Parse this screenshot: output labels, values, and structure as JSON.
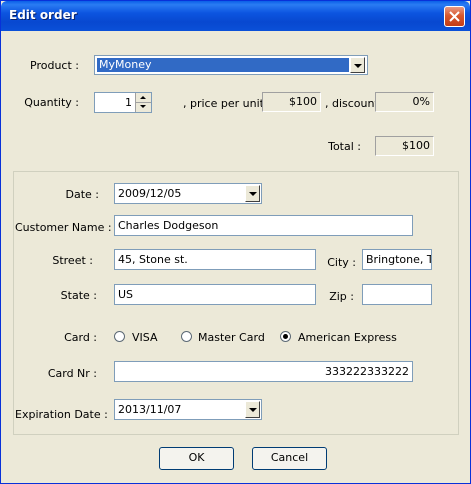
{
  "window": {
    "title": "Edit order"
  },
  "product": {
    "label": "Product :",
    "selected": "MyMoney"
  },
  "quantity": {
    "label": "Quantity :",
    "value": "1"
  },
  "price": {
    "label": ", price per unit :",
    "value": "$100"
  },
  "discount": {
    "label": ", discount",
    "value": "0%"
  },
  "total": {
    "label": "Total :",
    "value": "$100"
  },
  "customer": {
    "date_label": "Date :",
    "date": "2009/12/05",
    "name_label": "Customer Name :",
    "name": "Charles Dodgeson",
    "street_label": "Street :",
    "street": "45, Stone st.",
    "city_label": "City :",
    "city": "Bringtone, TX",
    "state_label": "State :",
    "state": "US",
    "zip_label": "Zip :",
    "zip": ""
  },
  "card": {
    "label": "Card :",
    "options": [
      "VISA",
      "Master Card",
      "American Express"
    ],
    "selected": "American Express",
    "nr_label": "Card Nr :",
    "nr": "333222333222",
    "exp_label": "Expiration Date :",
    "exp": "2013/11/07"
  },
  "buttons": {
    "ok": "OK",
    "cancel": "Cancel"
  }
}
